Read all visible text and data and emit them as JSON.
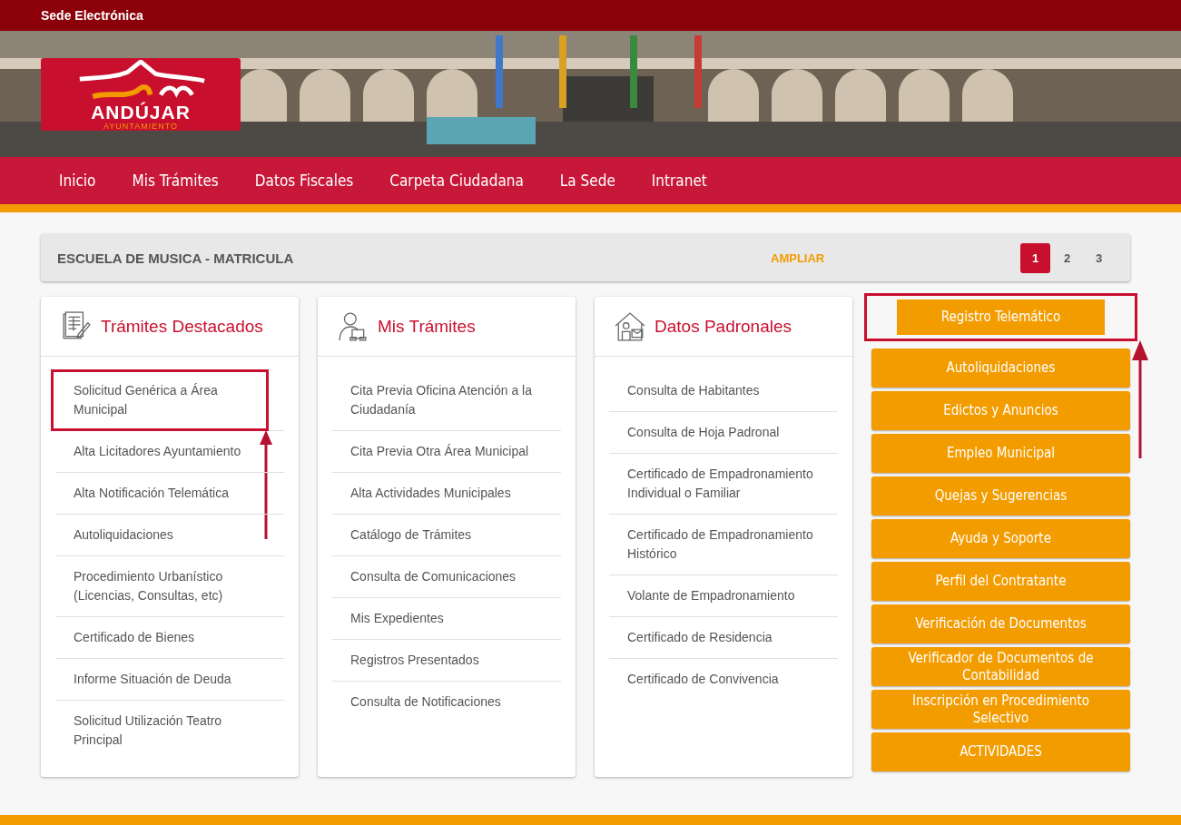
{
  "top_bar": {
    "title": "Sede Electrónica"
  },
  "logo": {
    "name": "ANDÚJAR",
    "subtitle": "AYUNTAMIENTO"
  },
  "hero": {
    "kind": "picture"
  },
  "nav": [
    "Inicio",
    "Mis Trámites",
    "Datos Fiscales",
    "Carpeta Ciudadana",
    "La Sede",
    "Intranet"
  ],
  "banner": {
    "title": "ESCUELA DE MUSICA - MATRICULA",
    "link": "AMPLIAR",
    "pages": [
      {
        "label": "1",
        "selected": true
      },
      {
        "label": "2",
        "selected": false
      },
      {
        "label": "3",
        "selected": false
      }
    ]
  },
  "cards": [
    {
      "title": "Trámites Destacados",
      "items": [
        {
          "label": "Solicitud Genérica a Área Municipal",
          "highlighted": true
        },
        {
          "label": "Alta Licitadores Ayuntamiento",
          "highlighted": false
        },
        {
          "label": "Alta Notificación Telemática",
          "highlighted": false
        },
        {
          "label": "Autoliquidaciones",
          "highlighted": false
        },
        {
          "label": "Procedimiento Urbanístico (Licencias, Consultas, etc)",
          "highlighted": false
        },
        {
          "label": "Certificado de Bienes",
          "highlighted": false
        },
        {
          "label": "Informe Situación de Deuda",
          "highlighted": false
        },
        {
          "label": "Solicitud Utilización Teatro Principal",
          "highlighted": false
        }
      ]
    },
    {
      "title": "Mis Trámites",
      "items": [
        {
          "label": "Cita Previa Oficina Atención a la Ciudadanía",
          "highlighted": false
        },
        {
          "label": "Cita Previa Otra Área Municipal",
          "highlighted": false
        },
        {
          "label": "Alta Actividades Municipales",
          "highlighted": false
        },
        {
          "label": "Catálogo de Trámites",
          "highlighted": false
        },
        {
          "label": "Consulta de Comunicaciones",
          "highlighted": false
        },
        {
          "label": "Mis Expedientes",
          "highlighted": false
        },
        {
          "label": "Registros Presentados",
          "highlighted": false
        },
        {
          "label": "Consulta de Notificaciones",
          "highlighted": false
        }
      ]
    },
    {
      "title": "Datos Padronales",
      "items": [
        {
          "label": "Consulta de Habitantes",
          "highlighted": false
        },
        {
          "label": "Consulta de Hoja Padronal",
          "highlighted": false
        },
        {
          "label": "Certificado de Empadronamiento Individual o Familiar",
          "highlighted": false
        },
        {
          "label": "Certificado de Empadronamiento Histórico",
          "highlighted": false
        },
        {
          "label": "Volante de Empadronamiento",
          "highlighted": false
        },
        {
          "label": "Certificado de Residencia",
          "highlighted": false
        },
        {
          "label": "Certificado de Convivencia",
          "highlighted": false
        }
      ]
    }
  ],
  "buttons": [
    {
      "label": "Registro Telemático",
      "highlighted": true
    },
    {
      "label": "Autoliquidaciones",
      "highlighted": false
    },
    {
      "label": "Edictos y Anuncios",
      "highlighted": false
    },
    {
      "label": "Empleo Municipal",
      "highlighted": false
    },
    {
      "label": "Quejas y Sugerencias",
      "highlighted": false
    },
    {
      "label": "Ayuda y Soporte",
      "highlighted": false
    },
    {
      "label": "Perfil del Contratante",
      "highlighted": false
    },
    {
      "label": "Verificación de Documentos",
      "highlighted": false
    },
    {
      "label": "Verificador de Documentos de Contabilidad",
      "highlighted": false
    },
    {
      "label": "Inscripción en Procedimiento Selectivo",
      "highlighted": false
    },
    {
      "label": "ACTIVIDADES",
      "highlighted": false
    }
  ]
}
